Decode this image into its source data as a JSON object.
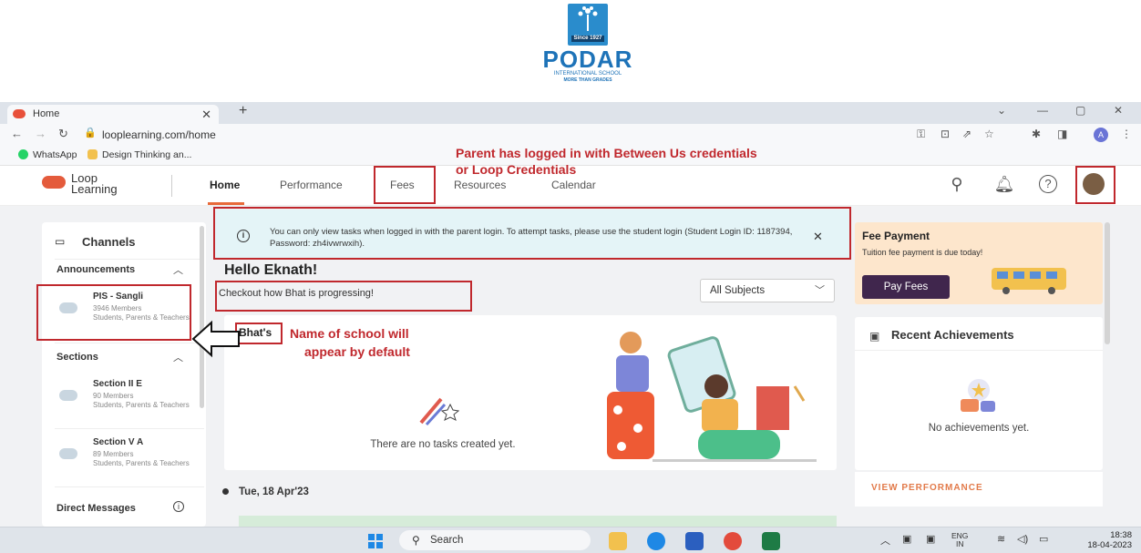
{
  "logo": {
    "since": "Since 1927",
    "name": "PODAR",
    "subtitle": "INTERNATIONAL SCHOOL",
    "tagline": "MORE THAN GRADES"
  },
  "browser": {
    "tab_title": "Home",
    "url": "looplearning.com/home",
    "bookmarks": [
      "WhatsApp",
      "Design Thinking an..."
    ],
    "profile_letter": "A"
  },
  "app": {
    "brand_line1": "Loop",
    "brand_line2": "Learning",
    "nav": [
      "Home",
      "Performance",
      "Fees",
      "Resources",
      "Calendar"
    ]
  },
  "sidebar": {
    "title": "Channels",
    "announcements_label": "Announcements",
    "announcements": [
      {
        "name": "PIS - Sangli",
        "members": "3946 Members",
        "desc": "Students, Parents & Teachers"
      }
    ],
    "sections_label": "Sections",
    "sections": [
      {
        "name": "Section II E",
        "members": "90 Members",
        "desc": "Students, Parents & Teachers"
      },
      {
        "name": "Section V A",
        "members": "89 Members",
        "desc": "Students, Parents & Teachers"
      }
    ],
    "dm_label": "Direct Messages"
  },
  "info_banner": "You can only view tasks when logged in with the parent login. To attempt tasks, please use the student login (Student Login ID: 1187394, Password: zh4ivwrwxih).",
  "main": {
    "greeting": "Hello Eknath!",
    "subtitle": "Checkout how Bhat is progressing!",
    "subject_filter": "All Subjects",
    "card_title": "Bhat's",
    "empty_tasks": "There are no tasks created yet.",
    "date": "Tue, 18 Apr'23"
  },
  "fee": {
    "title": "Fee Payment",
    "text": "Tuition fee payment is due today!",
    "button": "Pay Fees"
  },
  "achievements": {
    "title": "Recent Achievements",
    "empty": "No achievements yet.",
    "link": "VIEW PERFORMANCE"
  },
  "annotations": {
    "login_note_1": "Parent has logged in with Between Us credentials",
    "login_note_2": "or Loop Credentials",
    "school_note_1": "Name of school will",
    "school_note_2": "appear by default",
    "color": "#c0282d"
  },
  "taskbar": {
    "search": "Search",
    "lang1": "ENG",
    "lang2": "IN",
    "time": "18:38",
    "date": "18-04-2023"
  }
}
